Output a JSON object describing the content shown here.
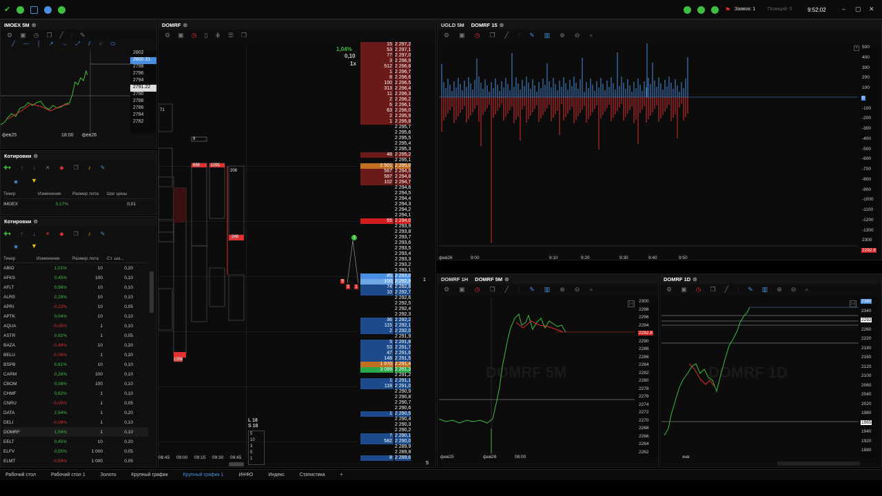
{
  "titlebar": {
    "orders": "Заявок: 1",
    "positions": "Позиций: 0",
    "time": "9:52:02"
  },
  "left_chart": {
    "tab": "IMOEX 5M",
    "y_ticks": [
      "2802",
      "2800.31",
      "2798",
      "2796",
      "2794",
      "2791.22",
      "2790",
      "2788",
      "2786",
      "2784",
      "2782"
    ],
    "x_ticks": [
      "фев25",
      "18:00",
      "фев26"
    ]
  },
  "quotes_top": {
    "tab": "Котировки",
    "headers": [
      "Тикер",
      "Изменение",
      "Размер лота",
      "Шаг цены"
    ],
    "rows": [
      {
        "ticker": "IMOEX",
        "change": "0,17%",
        "lot": "",
        "step": "0,01"
      }
    ]
  },
  "quotes_bottom": {
    "tab": "Котировки",
    "headers": [
      "Тикер",
      "Изменение",
      "Размер лота",
      "Ст. ша..."
    ],
    "rows": [
      {
        "t": "ABIO",
        "c": "1,01%",
        "l": "10",
        "s": "0,20",
        "dir": "up"
      },
      {
        "t": "AFKS",
        "c": "0,45%",
        "l": "100",
        "s": "0,10",
        "dir": "up"
      },
      {
        "t": "AFLT",
        "c": "0,96%",
        "l": "10",
        "s": "0,10",
        "dir": "up"
      },
      {
        "t": "ALRS",
        "c": "0,29%",
        "l": "10",
        "s": "0,10",
        "dir": "up"
      },
      {
        "t": "APRI",
        "c": "-0,22%",
        "l": "10",
        "s": "0,05",
        "dir": "down"
      },
      {
        "t": "APTK",
        "c": "0,04%",
        "l": "10",
        "s": "0,10",
        "dir": "up"
      },
      {
        "t": "AQUA",
        "c": "-0,05%",
        "l": "1",
        "s": "0,10",
        "dir": "down"
      },
      {
        "t": "ASTR",
        "c": "0,92%",
        "l": "1",
        "s": "0,05",
        "dir": "up"
      },
      {
        "t": "BAZA",
        "c": "-0,49%",
        "l": "10",
        "s": "0,20",
        "dir": "down"
      },
      {
        "t": "BELU",
        "c": "-0,06%",
        "l": "1",
        "s": "0,20",
        "dir": "down"
      },
      {
        "t": "BSPB",
        "c": "0,81%",
        "l": "10",
        "s": "0,10",
        "dir": "up"
      },
      {
        "t": "CARM",
        "c": "0,26%",
        "l": "100",
        "s": "0,10",
        "dir": "up"
      },
      {
        "t": "CBOM",
        "c": "0,08%",
        "l": "100",
        "s": "0,10",
        "dir": "up"
      },
      {
        "t": "CHMF",
        "c": "0,62%",
        "l": "1",
        "s": "0,10",
        "dir": "up"
      },
      {
        "t": "CNRU",
        "c": "-0,05%",
        "l": "1",
        "s": "0,05",
        "dir": "down"
      },
      {
        "t": "DATA",
        "c": "2,54%",
        "l": "1",
        "s": "0,20",
        "dir": "up"
      },
      {
        "t": "DELI",
        "c": "-0,08%",
        "l": "1",
        "s": "0,10",
        "dir": "down"
      },
      {
        "t": "DOMRF",
        "c": "1,04%",
        "l": "1",
        "s": "0,10",
        "dir": "up",
        "sel": true
      },
      {
        "t": "EELT",
        "c": "0,45%",
        "l": "10",
        "s": "0,20",
        "dir": "up"
      },
      {
        "t": "ELFV",
        "c": "0,55%",
        "l": "1 000",
        "s": "0,05",
        "dir": "up"
      },
      {
        "t": "ELMT",
        "c": "-0,59%",
        "l": "1 000",
        "s": "0,05",
        "dir": "down"
      }
    ]
  },
  "cluster": {
    "tab": "DOMRF",
    "x_ticks": [
      "08:45",
      "09:00",
      "09:15",
      "09:30",
      "09:45"
    ],
    "pct": "1,04%",
    "step": "0,10",
    "mult": "1x",
    "ls": [
      "L 18",
      "S 18"
    ]
  },
  "dom": {
    "asks": [
      [
        "15",
        "2 297,2"
      ],
      [
        "53",
        "2 297,1"
      ],
      [
        "77",
        "2 297,0"
      ],
      [
        "3",
        "2 296,9"
      ],
      [
        "512",
        "2 296,8"
      ],
      [
        "1",
        "2 296,7"
      ],
      [
        "8",
        "2 296,6"
      ],
      [
        "100",
        "2 296,5"
      ],
      [
        "313",
        "2 296,4"
      ],
      [
        "11",
        "2 296,3"
      ],
      [
        "2",
        "2 296,2"
      ],
      [
        "6",
        "2 296,1"
      ],
      [
        "63",
        "2 296,0"
      ],
      [
        "2",
        "2 295,9"
      ],
      [
        "1",
        "2 295,8"
      ],
      [
        "",
        "2 295,7"
      ],
      [
        "",
        "2 295,6"
      ],
      [
        "",
        "2 295,5"
      ],
      [
        "",
        "2 295,4"
      ],
      [
        "",
        "2 295,3"
      ],
      [
        "48",
        "2 295,2"
      ],
      [
        "",
        "2 295,1"
      ],
      [
        "2 501",
        "2 295,0"
      ],
      [
        "567",
        "2 294,9"
      ],
      [
        "587",
        "2 294,8"
      ],
      [
        "102",
        "2 294,7"
      ],
      [
        "",
        "2 294,6"
      ],
      [
        "",
        "2 294,5"
      ],
      [
        "",
        "2 294,4"
      ],
      [
        "",
        "2 294,3"
      ],
      [
        "",
        "2 294,2"
      ],
      [
        "",
        "2 294,1"
      ],
      [
        "65",
        "2 294,0"
      ],
      [
        "",
        "2 293,9"
      ],
      [
        "",
        "2 293,8"
      ],
      [
        "",
        "2 293,7"
      ],
      [
        "",
        "2 293,6"
      ],
      [
        "",
        "2 293,5"
      ],
      [
        "",
        "2 293,4"
      ],
      [
        "",
        "2 293,3"
      ],
      [
        "",
        "2 293,2"
      ],
      [
        "",
        "2 293,1"
      ]
    ],
    "bids": [
      [
        "85",
        "2 293,0"
      ],
      [
        "100",
        "2 292,9"
      ],
      [
        "74",
        "2 292,8"
      ],
      [
        "10",
        "2 292,7"
      ],
      [
        "",
        "2 292,6"
      ],
      [
        "",
        "2 292,5"
      ],
      [
        "",
        "2 292,4"
      ],
      [
        "",
        "2 292,3"
      ],
      [
        "36",
        "2 292,2"
      ],
      [
        "115",
        "2 292,1"
      ],
      [
        "2",
        "2 292,0"
      ],
      [
        "",
        "2 291,9"
      ],
      [
        "5",
        "2 291,8"
      ],
      [
        "53",
        "2 291,7"
      ],
      [
        "47",
        "2 291,6"
      ],
      [
        "148",
        "2 291,5"
      ],
      [
        "1 970",
        "2 291,4"
      ],
      [
        "3 089",
        "2 291,3"
      ],
      [
        "",
        "2 291,2"
      ],
      [
        "1",
        "2 291,1"
      ],
      [
        "118",
        "2 291,0"
      ],
      [
        "",
        "2 290,9"
      ],
      [
        "",
        "2 290,8"
      ],
      [
        "",
        "2 290,7"
      ],
      [
        "",
        "2 290,6"
      ],
      [
        "1",
        "2 290,5"
      ],
      [
        "",
        "2 290,4"
      ],
      [
        "",
        "2 290,3"
      ],
      [
        "",
        "2 290,2"
      ],
      [
        "7",
        "2 290,1"
      ],
      [
        "582",
        "2 290,0"
      ],
      [
        "",
        "2 289,9"
      ],
      [
        "",
        "2 289,8"
      ],
      [
        "8",
        "2 289,6"
      ]
    ]
  },
  "ugld": {
    "tabs": [
      "UGLD 5M",
      "DOMRF 15"
    ],
    "y_ticks": [
      "500",
      "400",
      "300",
      "200",
      "100",
      "0",
      "-100",
      "-200",
      "-300",
      "-400",
      "-500",
      "-600",
      "-700",
      "-800",
      "-900",
      "-1000",
      "-1100",
      "-1200",
      "-1300",
      "2300",
      "2292.8"
    ],
    "x_ticks": [
      "фев26",
      "9:00",
      "9:10",
      "9:20",
      "9:30",
      "9:40",
      "9:50"
    ]
  },
  "domrf5m": {
    "tabs": [
      "DOMRF 1H",
      "DOMRF 5M"
    ],
    "watermark": "DOMRF 5M",
    "y_ticks": [
      "2300",
      "2298",
      "2296",
      "2294",
      "2292.8",
      "2290",
      "2288",
      "2286",
      "2284",
      "2282",
      "2280",
      "2278",
      "2276",
      "2274",
      "2272",
      "2270",
      "2268",
      "2266",
      "2264",
      "2262"
    ],
    "x_ticks": [
      "фев25",
      "фев26",
      "08:00"
    ]
  },
  "domrf1d": {
    "tabs": [
      "DOMRF 1D"
    ],
    "watermark": "DOMRF 1D",
    "y_ticks": [
      "2380",
      "2340",
      "2292",
      "2260",
      "2220",
      "2180",
      "2160",
      "2120",
      "2100",
      "2060",
      "2040",
      "2020",
      "1980",
      "1965",
      "1940",
      "1920",
      "1880"
    ],
    "x_ticks": [
      "янв"
    ]
  },
  "statusbar": [
    "Рабочий стол",
    "Рабочий стол 1",
    "Золото",
    "Крупный график",
    "Крупный график 1",
    "ИНФО",
    "Индекс",
    "Статистика",
    "+"
  ]
}
